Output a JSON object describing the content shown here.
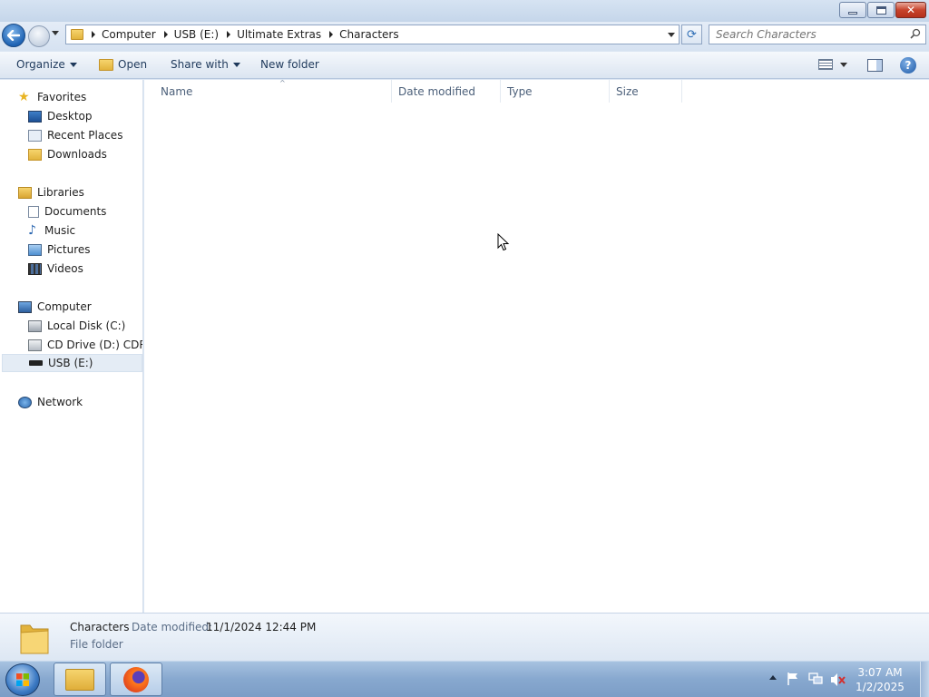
{
  "window": {
    "minimize_icon": "minimize-icon",
    "maximize_icon": "restore-icon",
    "close_icon": "close-icon",
    "close_glyph": "✕"
  },
  "nav": {
    "breadcrumbs": [
      "Computer",
      "USB (E:)",
      "Ultimate Extras",
      "Characters"
    ],
    "refresh_glyph": "⟳",
    "search_placeholder": "Search Characters"
  },
  "commands": {
    "organize": "Organize",
    "open": "Open",
    "share_with": "Share with",
    "new_folder": "New folder",
    "help_glyph": "?"
  },
  "sidebar": {
    "favorites": {
      "label": "Favorites",
      "items": [
        "Desktop",
        "Recent Places",
        "Downloads"
      ]
    },
    "libraries": {
      "label": "Libraries",
      "items": [
        "Documents",
        "Music",
        "Pictures",
        "Videos"
      ]
    },
    "computer": {
      "label": "Computer",
      "items": [
        "Local Disk (C:)",
        "CD Drive (D:) CDROM",
        "USB (E:)"
      ],
      "selected": "USB (E:)"
    },
    "network": {
      "label": "Network"
    },
    "star_glyph": "★",
    "music_glyph": "♪"
  },
  "file_list": {
    "columns": [
      "Name",
      "Date modified",
      "Type",
      "Size"
    ],
    "sort_glyph": "^",
    "rows": []
  },
  "details": {
    "name": "Characters",
    "date_label": "Date modified:",
    "date_value": "11/1/2024 12:44 PM",
    "type": "File folder"
  },
  "taskbar": {
    "time": "3:07 AM",
    "date": "1/2/2025",
    "pinned": [
      "windows-explorer",
      "firefox"
    ]
  }
}
